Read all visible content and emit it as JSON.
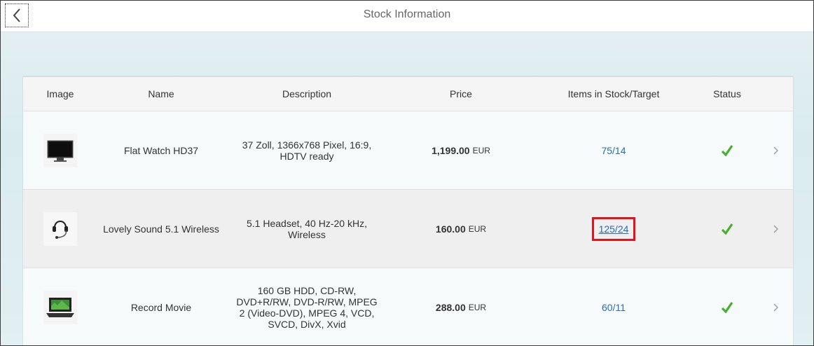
{
  "header": {
    "title": "Stock Information"
  },
  "icons": {
    "back": "chevron-left-icon",
    "status": "checkmark-icon",
    "nav": "chevron-right-icon"
  },
  "colors": {
    "status_ok": "#47b02c",
    "link": "#2b6cb0",
    "highlight": "#e3141c"
  },
  "table": {
    "columns": [
      "Image",
      "Name",
      "Description",
      "Price",
      "Items in Stock/Target",
      "Status"
    ],
    "rows": [
      {
        "name": "Flat Watch HD37",
        "description": "37 Zoll, 1366x768 Pixel, 16:9, HDTV ready",
        "price": "1,199.00",
        "currency": "EUR",
        "stock": "75/14",
        "image": "monitor"
      },
      {
        "name": "Lovely Sound 5.1 Wireless",
        "description": "5.1 Headset, 40 Hz-20 kHz, Wireless",
        "price": "160.00",
        "currency": "EUR",
        "stock": "125/24",
        "image": "headset"
      },
      {
        "name": "Record Movie",
        "description": "160 GB HDD, CD-RW, DVD+R/RW, DVD-R/RW, MPEG 2 (Video-DVD), MPEG 4, VCD, SVCD, DivX, Xvid",
        "price": "288.00",
        "currency": "EUR",
        "stock": "60/11",
        "image": "laptop"
      }
    ]
  }
}
